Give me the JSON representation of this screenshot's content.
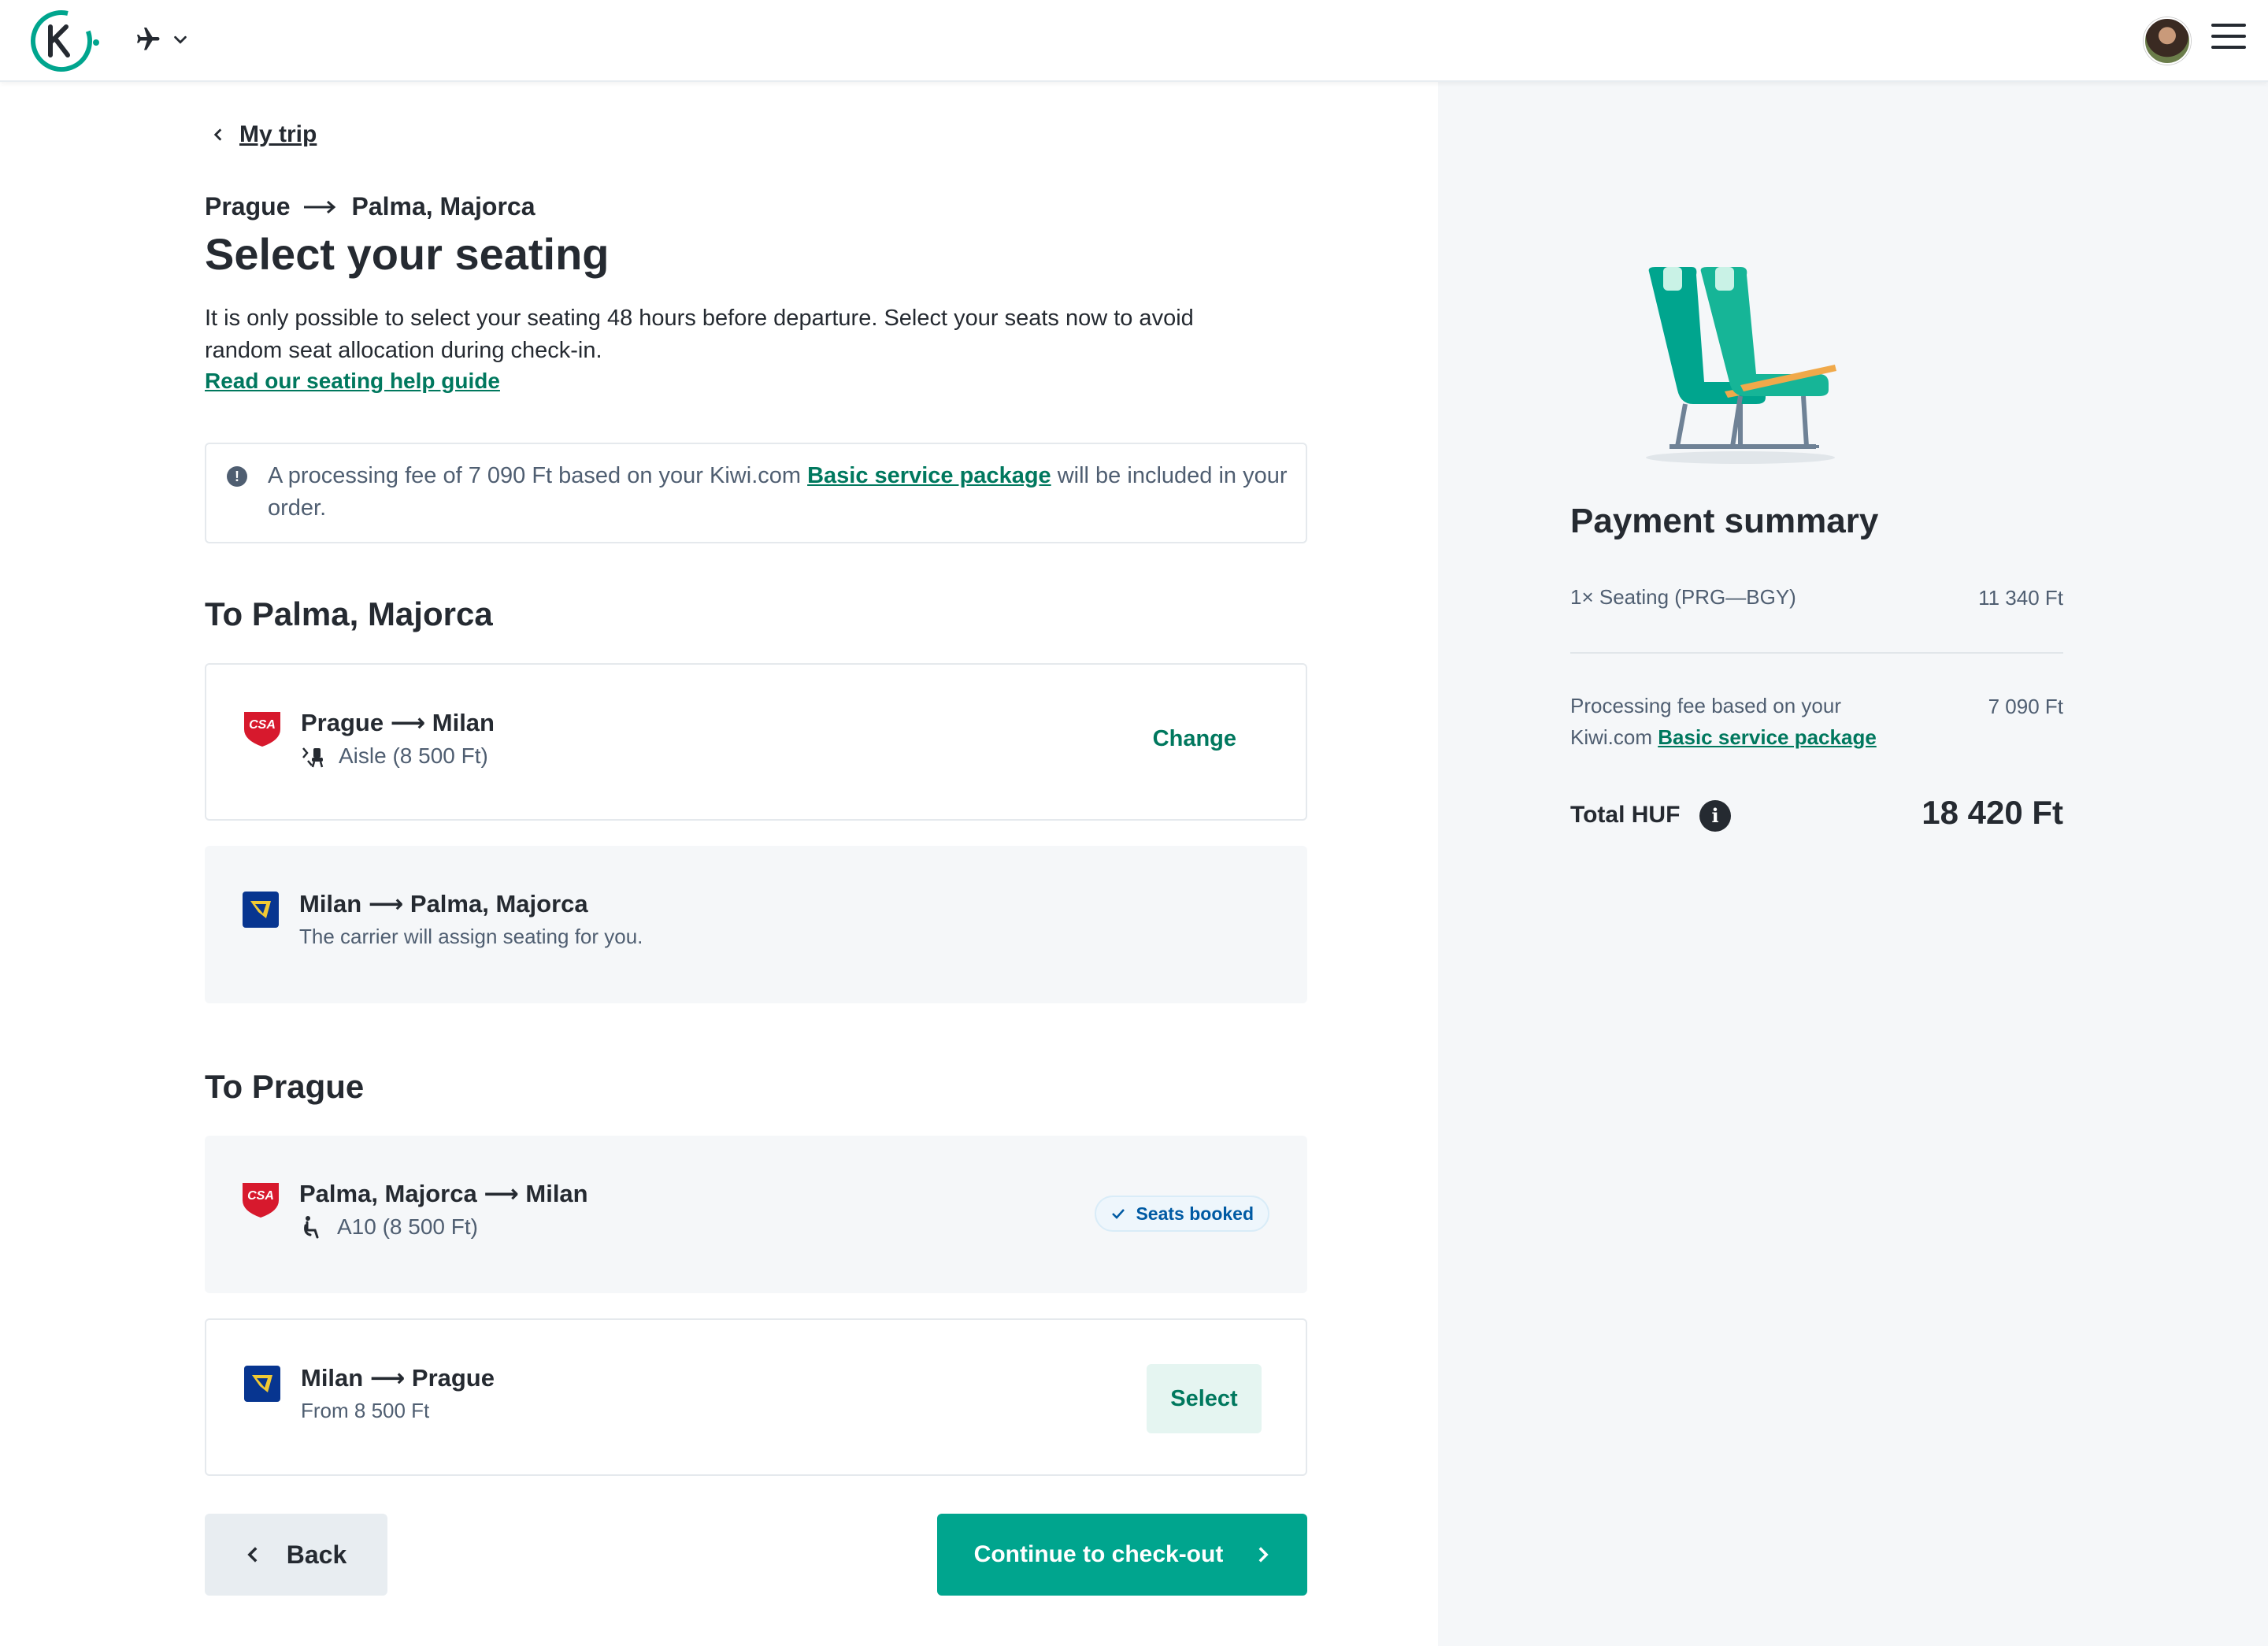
{
  "header": {
    "logo_icon": "kiwi-logo",
    "product_icon": "airplane-icon",
    "menu_icon": "hamburger-icon"
  },
  "nav": {
    "back_label": "My trip"
  },
  "trip": {
    "origin": "Prague",
    "destination": "Palma, Majorca"
  },
  "page_title": "Select your seating",
  "intro_text": "It is only possible to select your seating 48 hours before departure. Select your seats now to avoid random seat allocation during check-in.",
  "help_link": "Read our seating help guide",
  "notice": {
    "before": "A processing fee of 7 090 Ft based on your Kiwi.com ",
    "link": "Basic service package",
    "after": " will be included in your order."
  },
  "sections": [
    {
      "title": "To Palma, Majorca",
      "segments": [
        {
          "route": "Prague ⟶ Milan",
          "detail": "Aisle (8 500 Ft)",
          "action": "Change",
          "carrier": "CSA"
        },
        {
          "route": "Milan ⟶ Palma, Majorca",
          "detail": "The carrier will assign seating for you.",
          "carrier": "Ryanair"
        }
      ]
    },
    {
      "title": "To Prague",
      "segments": [
        {
          "route": "Palma, Majorca ⟶ Milan",
          "detail": "A10 (8 500 Ft)",
          "badge": "Seats booked",
          "carrier": "CSA"
        },
        {
          "route": "Milan ⟶ Prague",
          "detail": "From 8 500 Ft",
          "action": "Select",
          "carrier": "Ryanair"
        }
      ]
    }
  ],
  "buttons": {
    "back": "Back",
    "continue": "Continue to check-out"
  },
  "summary": {
    "title": "Payment summary",
    "line1_label": "1× Seating (PRG—BGY)",
    "line1_value": "11 340 Ft",
    "fee_label_1": "Processing fee based on your",
    "fee_label_2": "Kiwi.com ",
    "fee_link": "Basic service package",
    "fee_value": "7 090 Ft",
    "total_label": "Total HUF",
    "total_value": "18 420 Ft"
  },
  "colors": {
    "accent": "#00a58e",
    "link": "#00785e",
    "panel": "#f5f7f9"
  }
}
